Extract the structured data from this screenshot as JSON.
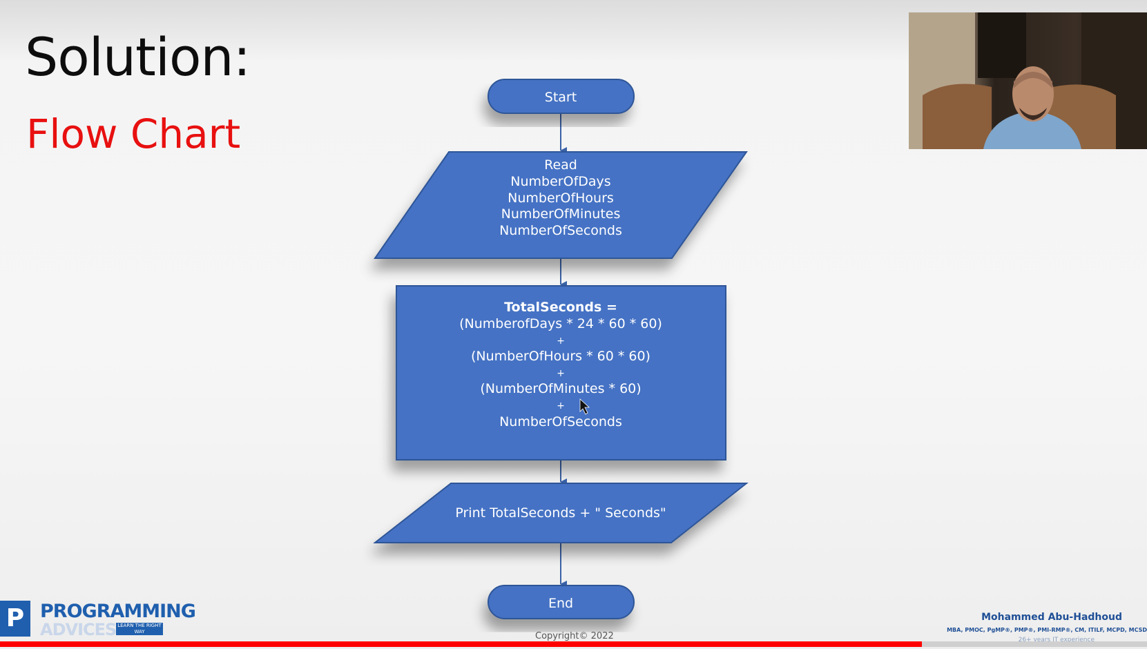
{
  "slide": {
    "title": "Solution:",
    "subtitle": "Flow Chart",
    "subtitle_color": "#e81010",
    "copyright": "Copyright© 2022"
  },
  "flowchart": {
    "fill_color": "#4472c4",
    "start": "Start",
    "input": {
      "lines": [
        "Read",
        "NumberOfDays",
        "NumberOfHours",
        "NumberOfMinutes",
        "NumberOfSeconds"
      ]
    },
    "process": {
      "heading": "TotalSeconds =",
      "lines": [
        "(NumberofDays * 24 * 60 * 60)",
        "+",
        "(NumberOfHours * 60 * 60)",
        "+",
        "(NumberOfMinutes * 60)",
        "+",
        "NumberOfSeconds"
      ]
    },
    "output": "Print TotalSeconds + \" Seconds\"",
    "end": "End"
  },
  "branding": {
    "logo_line1": "PROGRAMMING",
    "logo_line2": "ADVICES",
    "logo_tagline": "LEARN THE RIGHT WAY",
    "presenter_name": "Mohammed Abu-Hadhoud",
    "presenter_credentials": "MBA, PMOC, PgMP®, PMP®, PMI-RMP®, CM, ITILF, MCPD, MCSD",
    "presenter_experience": "26+ years IT experience",
    "brand_color": "#1f5fae"
  },
  "video": {
    "progress": 0.804,
    "progress_color": "#ff0000"
  }
}
